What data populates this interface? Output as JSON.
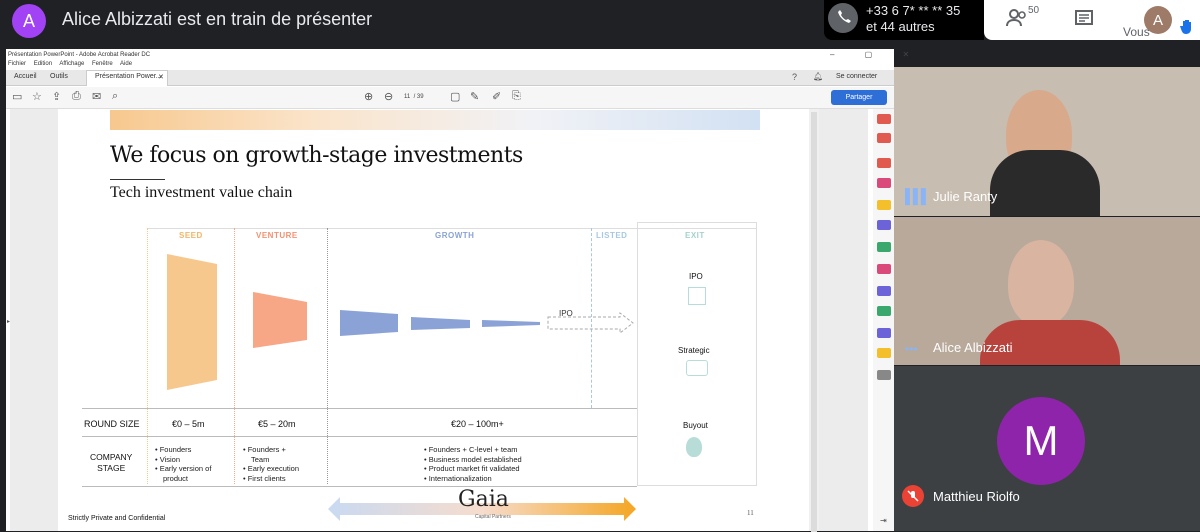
{
  "meet": {
    "presenter_initial": "A",
    "presenting_text": "Alice Albizzati est en train de présenter",
    "phone_line1": "+33 6 7* ** ** 35",
    "phone_line2": "et 44 autres",
    "people_count": "50",
    "me_initial": "A",
    "me_label": "Vous",
    "icons": [
      "phone-icon",
      "people-icon",
      "chat-icon",
      "raise-hand-icon"
    ]
  },
  "acrobat": {
    "window_title": "Présentation PowerPoint - Adobe Acrobat Reader DC",
    "menu": [
      "Fichier",
      "Edition",
      "Affichage",
      "Fenêtre",
      "Aide"
    ],
    "tabs": [
      "Accueil",
      "Outils",
      "Présentation Power..."
    ],
    "page_current": "11",
    "page_total": "/ 39",
    "connect_label": "Se connecter",
    "share_label": "Partager"
  },
  "slide": {
    "title": "We focus on growth-stage investments",
    "subtitle": "Tech investment value chain",
    "stages": {
      "seed": "SEED",
      "venture": "VENTURE",
      "growth": "GROWTH",
      "listed": "LISTED",
      "exit": "EXIT"
    },
    "stage_colors": {
      "seed": "#f7c88e",
      "venture": "#f7a686",
      "growth": "#8aa2d6",
      "listed": "#b8d4ea",
      "exit": "#b8ddd8"
    },
    "ipo_arrow_label": "IPO",
    "round_size_label": "ROUND SIZE",
    "round_sizes": [
      "€0 – 5m",
      "€5 – 20m",
      "€20 – 100m+"
    ],
    "company_stage_label_1": "COMPANY",
    "company_stage_label_2": "STAGE",
    "seed_bullets": [
      "Founders",
      "Vision",
      "Early version of",
      "product"
    ],
    "venture_bullets": [
      "Founders +",
      "Team",
      "Early execution",
      "First clients"
    ],
    "growth_bullets": [
      "Founders + C-level + team",
      "Business model established",
      "Product market fit validated",
      "Internationalization"
    ],
    "exit_options": [
      "IPO",
      "Strategic",
      "Buyout"
    ],
    "footer_left": "Strictly Private and Confidential",
    "brand": "Gaia",
    "brand_sub": "Capital Partners",
    "page_number": "11"
  },
  "participants": [
    {
      "name": "Julie Ranty"
    },
    {
      "name": "Alice Albizzati"
    },
    {
      "name": "Matthieu Riolfo",
      "initial": "M"
    }
  ]
}
